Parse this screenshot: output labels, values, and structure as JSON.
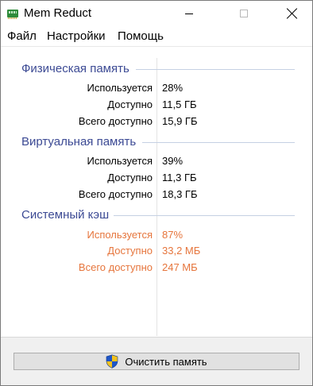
{
  "window": {
    "title": "Mem Reduct"
  },
  "menu": {
    "file": "Файл",
    "settings": "Настройки",
    "help": "Помощь"
  },
  "physical": {
    "title": "Физическая память",
    "rows": [
      {
        "label": "Используется",
        "value": "28%"
      },
      {
        "label": "Доступно",
        "value": "11,5 ГБ"
      },
      {
        "label": "Всего доступно",
        "value": "15,9 ГБ"
      }
    ]
  },
  "virtual": {
    "title": "Виртуальная память",
    "rows": [
      {
        "label": "Используется",
        "value": "39%"
      },
      {
        "label": "Доступно",
        "value": "11,3 ГБ"
      },
      {
        "label": "Всего доступно",
        "value": "18,3 ГБ"
      }
    ]
  },
  "cache": {
    "title": "Системный кэш",
    "rows": [
      {
        "label": "Используется",
        "value": "87%"
      },
      {
        "label": "Доступно",
        "value": "33,2 МБ"
      },
      {
        "label": "Всего доступно",
        "value": "247 МБ"
      }
    ]
  },
  "actions": {
    "clean_label": "Очистить память"
  },
  "colors": {
    "group_title": "#3c4a94",
    "warning": "#e6753c",
    "text": "#000000"
  },
  "icons": {
    "app": "mem-reduct-ram-icon",
    "clean": "uac-shield-icon",
    "minimize": "minimize-icon",
    "maximize": "maximize-icon",
    "close": "close-icon"
  }
}
